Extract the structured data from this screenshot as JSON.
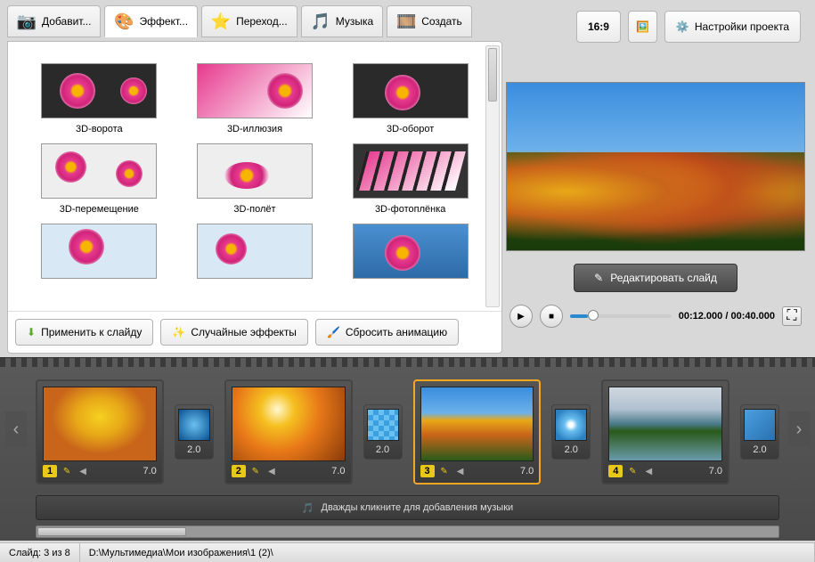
{
  "tabs": {
    "add": "Добавит...",
    "effects": "Эффект...",
    "transitions": "Переход...",
    "music": "Музыка",
    "create": "Создать"
  },
  "toolbar": {
    "aspect": "16:9",
    "settings": "Настройки проекта"
  },
  "effects": {
    "items": [
      {
        "label": "3D-ворота"
      },
      {
        "label": "3D-иллюзия"
      },
      {
        "label": "3D-оборот"
      },
      {
        "label": "3D-перемещение"
      },
      {
        "label": "3D-полёт"
      },
      {
        "label": "3D-фотоплёнка"
      }
    ]
  },
  "buttons": {
    "apply": "Применить к слайду",
    "random": "Случайные эффекты",
    "reset": "Сбросить анимацию",
    "edit_slide": "Редактировать слайд"
  },
  "playback": {
    "current": "00:12.000",
    "sep": " / ",
    "total": "00:40.000"
  },
  "timeline": {
    "slides": [
      {
        "num": "1",
        "dur": "7.0"
      },
      {
        "num": "2",
        "dur": "7.0"
      },
      {
        "num": "3",
        "dur": "7.0"
      },
      {
        "num": "4",
        "dur": "7.0"
      }
    ],
    "transitions": [
      {
        "dur": "2.0"
      },
      {
        "dur": "2.0"
      },
      {
        "dur": "2.0"
      },
      {
        "dur": "2.0"
      }
    ],
    "music_hint": "Дважды кликните для добавления музыки"
  },
  "status": {
    "slide": "Слайд: 3 из 8",
    "path": "D:\\Мультимедиа\\Мои изображения\\1 (2)\\"
  }
}
